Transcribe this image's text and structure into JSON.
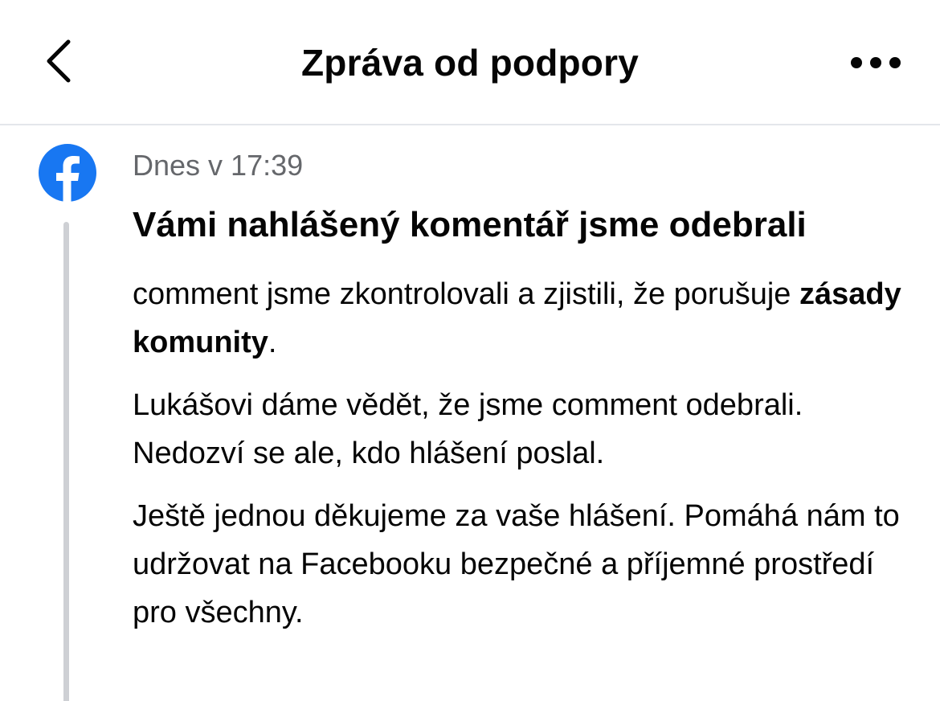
{
  "header": {
    "title": "Zpráva od podpory",
    "back_icon": "chevron-left-icon",
    "more_icon": "more-horizontal-icon"
  },
  "message": {
    "sender_icon": "facebook-logo-icon",
    "brand_color": "#1877F2",
    "timestamp": "Dnes v 17:39",
    "title": "Vámi nahlášený komentář jsme odebrali",
    "paragraph1": {
      "before": "comment jsme zkontrolovali a zjistili, že porušuje ",
      "link": "zásady komunity",
      "after": "."
    },
    "paragraph2": "Lukášovi dáme vědět, že jsme comment odebrali. Nedozví se ale, kdo hlášení poslal.",
    "paragraph3": "Ještě jednou děkujeme za vaše hlášení. Pomáhá nám to udržovat na Facebooku bezpečné a příjemné prostředí pro všechny."
  }
}
